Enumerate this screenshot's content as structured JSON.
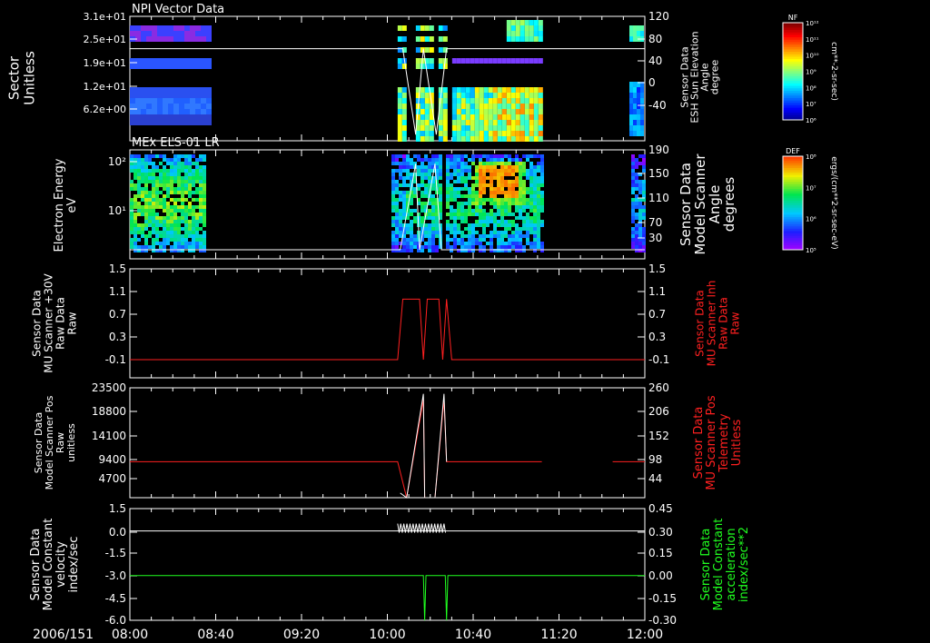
{
  "footer": {
    "date_label": "2006/151",
    "time_ticks": [
      "08:00",
      "08:40",
      "09:20",
      "10:00",
      "10:40",
      "11:20",
      "12:00"
    ]
  },
  "colors": {
    "background": "#000000",
    "axis": "#ffffff",
    "red_trace": "#ff2020",
    "green_trace": "#20ff20",
    "white_trace": "#ffffff",
    "red_label": "#ff2020",
    "green_label": "#20ff20"
  },
  "chart_data": [
    {
      "type": "heatmap",
      "title": "NPI Vector Data",
      "ylabel": "Sector\nUnitless",
      "yticks": [
        "3.1e+01",
        "2.5e+01",
        "1.9e+01",
        "1.2e+01",
        "6.2e+00"
      ],
      "y2label": "Sensor Data\nESH Sun Elevation\nAngle\ndegree",
      "y2ticks": [
        "120",
        "80",
        "40",
        "0",
        "-40"
      ],
      "y2lim": [
        -80,
        120
      ],
      "colorbar": {
        "label": "NF",
        "units": "cm**-2-sr-sec)",
        "ticks": [
          "10¹²",
          "10¹¹",
          "10¹⁰",
          "10⁹",
          "10⁸",
          "10⁷",
          "10⁶"
        ]
      },
      "overlay": {
        "name": "Sun Elevation",
        "x_hours": [
          8.0,
          10.12,
          10.22,
          10.28,
          10.38,
          10.46,
          10.55,
          12.0
        ],
        "values": [
          68,
          68,
          -70,
          68,
          -70,
          68,
          68,
          68
        ]
      }
    },
    {
      "type": "heatmap",
      "title": "MEx ELS-01 LR",
      "ylabel": "Electron Energy\neV",
      "yticks": [
        "10²",
        "10¹"
      ],
      "y2label": "Sensor Data\nModel Scanner\nAngle\ndegrees",
      "y2ticks": [
        "190",
        "150",
        "110",
        "70",
        "30"
      ],
      "y2lim": [
        10,
        190
      ],
      "colorbar": {
        "label": "DEF",
        "units": "ergs/(cm**2-sr-sec-eV)",
        "ticks": [
          "10⁸",
          "10⁷",
          "10⁶",
          "10⁵"
        ]
      },
      "overlay": {
        "name": "Scanner Angle",
        "x_hours": [
          8.0,
          10.05,
          10.1,
          10.22,
          10.25,
          10.37,
          10.42,
          12.0
        ],
        "values": [
          10,
          10,
          10,
          165,
          10,
          165,
          10,
          10
        ]
      }
    },
    {
      "type": "line",
      "ylabel": "Sensor Data\nMU Scanner +30V\nRaw Data\nRaw",
      "yticks": [
        "1.5",
        "1.1",
        "0.7",
        "0.3",
        "-0.1"
      ],
      "ylim": [
        -0.3,
        1.5
      ],
      "y2label": "Sensor Data\nMU Scanner Inh\nRaw Data\nRaw",
      "y2ticks": [
        "1.5",
        "1.1",
        "0.7",
        "0.3",
        "-0.1"
      ],
      "series": [
        {
          "color": "red",
          "x_hours": [
            8.0,
            10.08,
            10.12,
            10.25,
            10.28,
            10.31,
            10.4,
            10.43,
            10.46,
            10.5,
            12.0
          ],
          "values": [
            0.0,
            0.0,
            1.0,
            1.0,
            0.0,
            1.0,
            1.0,
            0.0,
            1.0,
            0.0,
            0.0
          ]
        }
      ]
    },
    {
      "type": "line",
      "ylabel": "Sensor Data\nModel Scanner Pos\nRaw\nunitless",
      "yticks": [
        "23500",
        "18800",
        "14100",
        "9400",
        "4700"
      ],
      "ylim": [
        0,
        23500
      ],
      "y2label": "Sensor Data\nMU Scanner Pos\nTelemetry\nUnitless",
      "y2ticks": [
        "260",
        "206",
        "152",
        "98",
        "44"
      ],
      "series": [
        {
          "color": "red",
          "x_hours": [
            8.0,
            10.08,
            10.15,
            10.28,
            10.29,
            10.37,
            10.44,
            10.46,
            11.2
          ],
          "values": [
            7700,
            7700,
            0,
            21000,
            0,
            0,
            21000,
            7700,
            7700
          ]
        },
        {
          "color": "red",
          "x_hours": [
            11.75,
            12.0
          ],
          "values": [
            7700,
            7700
          ]
        },
        {
          "color": "white",
          "x_hours": [
            10.1,
            10.15,
            10.28,
            10.29,
            10.37,
            10.44,
            10.46
          ],
          "values": [
            1000,
            0,
            22200,
            0,
            0,
            22200,
            7700
          ]
        }
      ]
    },
    {
      "type": "line",
      "ylabel": "Sensor Data\nModel Constant\nvelocity\nindex/sec",
      "yticks": [
        "1.5",
        "0.0",
        "-1.5",
        "-3.0",
        "-4.5",
        "-6.0"
      ],
      "ylim": [
        -6.0,
        1.5
      ],
      "y2label": "Sensor Data\nModel Constant\nacceleration\nindex/sec**2",
      "y2ticks": [
        "0.45",
        "0.30",
        "0.15",
        "0.00",
        "-0.15",
        "-0.30"
      ],
      "y2lim": [
        -0.3,
        0.45
      ],
      "series": [
        {
          "color": "green",
          "axis": "right",
          "x_hours": [
            8.0,
            10.28,
            10.29,
            10.3,
            10.45,
            10.46,
            10.47,
            12.0
          ],
          "values": [
            0.0,
            0.0,
            -0.3,
            0.0,
            0.0,
            -0.3,
            0.0,
            0.0
          ]
        },
        {
          "color": "white",
          "axis": "left",
          "x_hours": [
            8.0,
            10.08,
            10.46,
            12.0
          ],
          "values": [
            0.0,
            0.0,
            0.0,
            0.0
          ]
        }
      ]
    }
  ]
}
